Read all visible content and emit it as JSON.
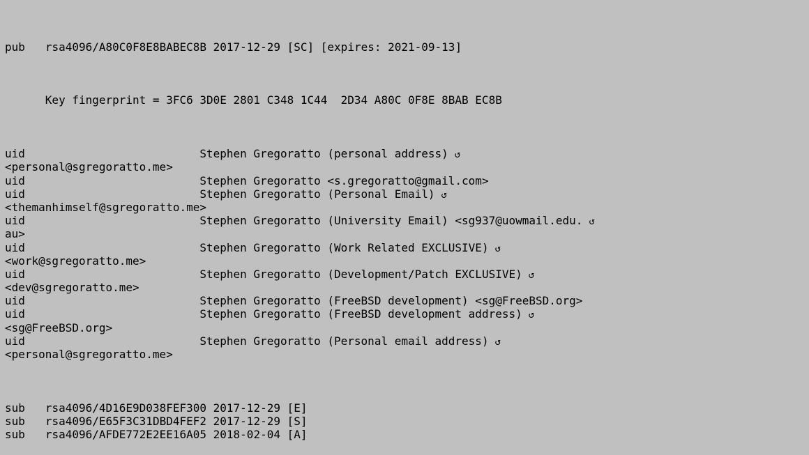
{
  "key_listing": {
    "pub": {
      "prefix": "pub",
      "key": "rsa4096/A80C0F8E8BABEC8B",
      "date": "2017-12-29",
      "caps": "[SC]",
      "expires": "[expires: 2021-09-13]"
    },
    "fingerprint": "      Key fingerprint = 3FC6 3D0E 2801 C348 1C44  2D34 A80C 0F8E 8BAB EC8B",
    "uids": [
      {
        "prefix": "uid",
        "text": "Stephen Gregoratto (personal address)",
        "wrapped": true,
        "continuation": "<personal@sgregoratto.me>"
      },
      {
        "prefix": "uid",
        "text": "Stephen Gregoratto <s.gregoratto@gmail.com>",
        "wrapped": false,
        "continuation": ""
      },
      {
        "prefix": "uid",
        "text": "Stephen Gregoratto (Personal Email)",
        "wrapped": true,
        "continuation": "<themanhimself@sgregoratto.me>"
      },
      {
        "prefix": "uid",
        "text": "Stephen Gregoratto (University Email) <sg937@uowmail.edu.",
        "wrapped": true,
        "continuation": "au>"
      },
      {
        "prefix": "uid",
        "text": "Stephen Gregoratto (Work Related EXCLUSIVE)",
        "wrapped": true,
        "continuation": "<work@sgregoratto.me>"
      },
      {
        "prefix": "uid",
        "text": "Stephen Gregoratto (Development/Patch EXCLUSIVE)",
        "wrapped": true,
        "continuation": "<dev@sgregoratto.me>"
      },
      {
        "prefix": "uid",
        "text": "Stephen Gregoratto (FreeBSD development) <sg@FreeBSD.org>",
        "wrapped": false,
        "continuation": ""
      },
      {
        "prefix": "uid",
        "text": "Stephen Gregoratto (FreeBSD development address)",
        "wrapped": true,
        "continuation": "<sg@FreeBSD.org>"
      },
      {
        "prefix": "uid",
        "text": "Stephen Gregoratto (Personal email address)",
        "wrapped": true,
        "continuation": "<personal@sgregoratto.me>"
      }
    ],
    "subs": [
      {
        "prefix": "sub",
        "key": "rsa4096/4D16E9D038FEF300",
        "date": "2017-12-29",
        "caps": "[E]"
      },
      {
        "prefix": "sub",
        "key": "rsa4096/E65F3C31DBD4FEF2",
        "date": "2017-12-29",
        "caps": "[S]"
      },
      {
        "prefix": "sub",
        "key": "rsa4096/AFDE772E2EE16A05",
        "date": "2018-02-04",
        "caps": "[A]"
      }
    ],
    "wrap_symbol": "↺",
    "colors": {
      "background": "#c0c0c0",
      "text": "#000000"
    }
  }
}
